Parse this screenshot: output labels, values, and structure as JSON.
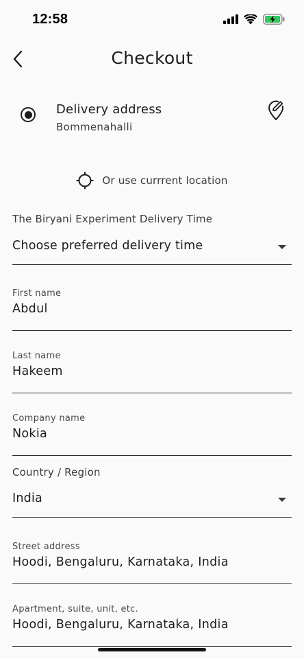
{
  "status_bar": {
    "time": "12:58",
    "icons": [
      "cellular-signal-icon",
      "wifi-icon",
      "battery-charging-icon"
    ],
    "battery_color": "#34c759"
  },
  "header": {
    "title": "Checkout",
    "back_icon": "chevron-left-icon"
  },
  "delivery_address": {
    "title": "Delivery address",
    "subtitle": "Bommenahalli",
    "selected": true,
    "edit_icon": "edit-location-icon"
  },
  "use_location": {
    "label": "Or use currrent location",
    "icon": "crosshair-icon"
  },
  "delivery_time": {
    "label": "The Biryani Experiment Delivery Time",
    "value": "Choose preferred delivery time"
  },
  "fields": {
    "first_name": {
      "label": "First name",
      "value": "Abdul"
    },
    "last_name": {
      "label": "Last name",
      "value": "Hakeem"
    },
    "company": {
      "label": "Company name",
      "value": "Nokia"
    },
    "street": {
      "label": "Street address",
      "value": "Hoodi, Bengaluru, Karnataka, India"
    },
    "apartment": {
      "label": "Apartment, suite, unit, etc.",
      "value": "Hoodi, Bengaluru, Karnataka, India"
    }
  },
  "country": {
    "label": "Country / Region",
    "value": "India"
  }
}
